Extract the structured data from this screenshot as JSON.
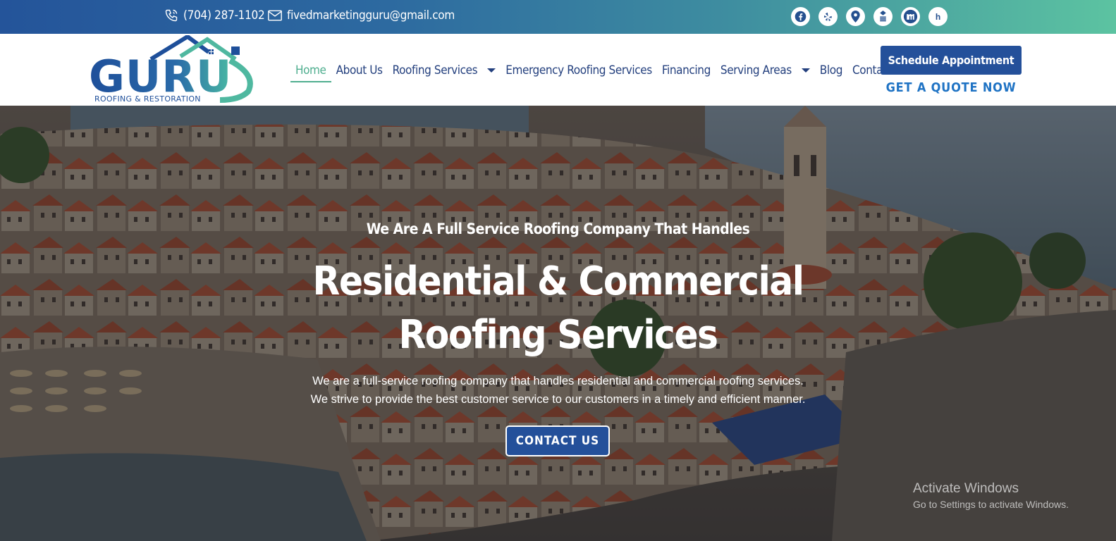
{
  "topbar": {
    "phone": "(704) 287-1102",
    "email": "fivedmarketingguru@gmail.com",
    "social_icons": [
      "facebook-icon",
      "yelp-icon",
      "map-pin-icon",
      "bbb-icon",
      "m-icon",
      "houzz-icon"
    ],
    "houzz_glyph": "h"
  },
  "logo": {
    "wordmark": "GURU",
    "tagline": "ROOFING & RESTORATION"
  },
  "nav": {
    "items": [
      "Home",
      "About Us",
      "Roofing Services",
      "Emergency Roofing Services",
      "Financing",
      "Serving Areas",
      "Blog",
      "Contact Us"
    ],
    "active": "Home"
  },
  "header": {
    "schedule_label": "Schedule Appointment",
    "quote_label": "GET A QUOTE NOW"
  },
  "hero": {
    "subtitle": "We Are A Full Service Roofing Company That Handles",
    "headline_line1": "Residential & Commercial",
    "headline_line2": "Roofing Services",
    "desc_line1": "We are a full-service roofing company that handles residential and commercial roofing services.",
    "desc_line2": "We strive to provide the best customer service to our customers in a timely and efficient manner.",
    "cta_label": "CONTACT US"
  },
  "watermark": {
    "title": "Activate Windows",
    "subtitle": "Go to Settings to activate Windows."
  },
  "colors": {
    "brand_blue": "#24509a",
    "brand_teal": "#4fae8f",
    "link_blue": "#1f73c4"
  }
}
